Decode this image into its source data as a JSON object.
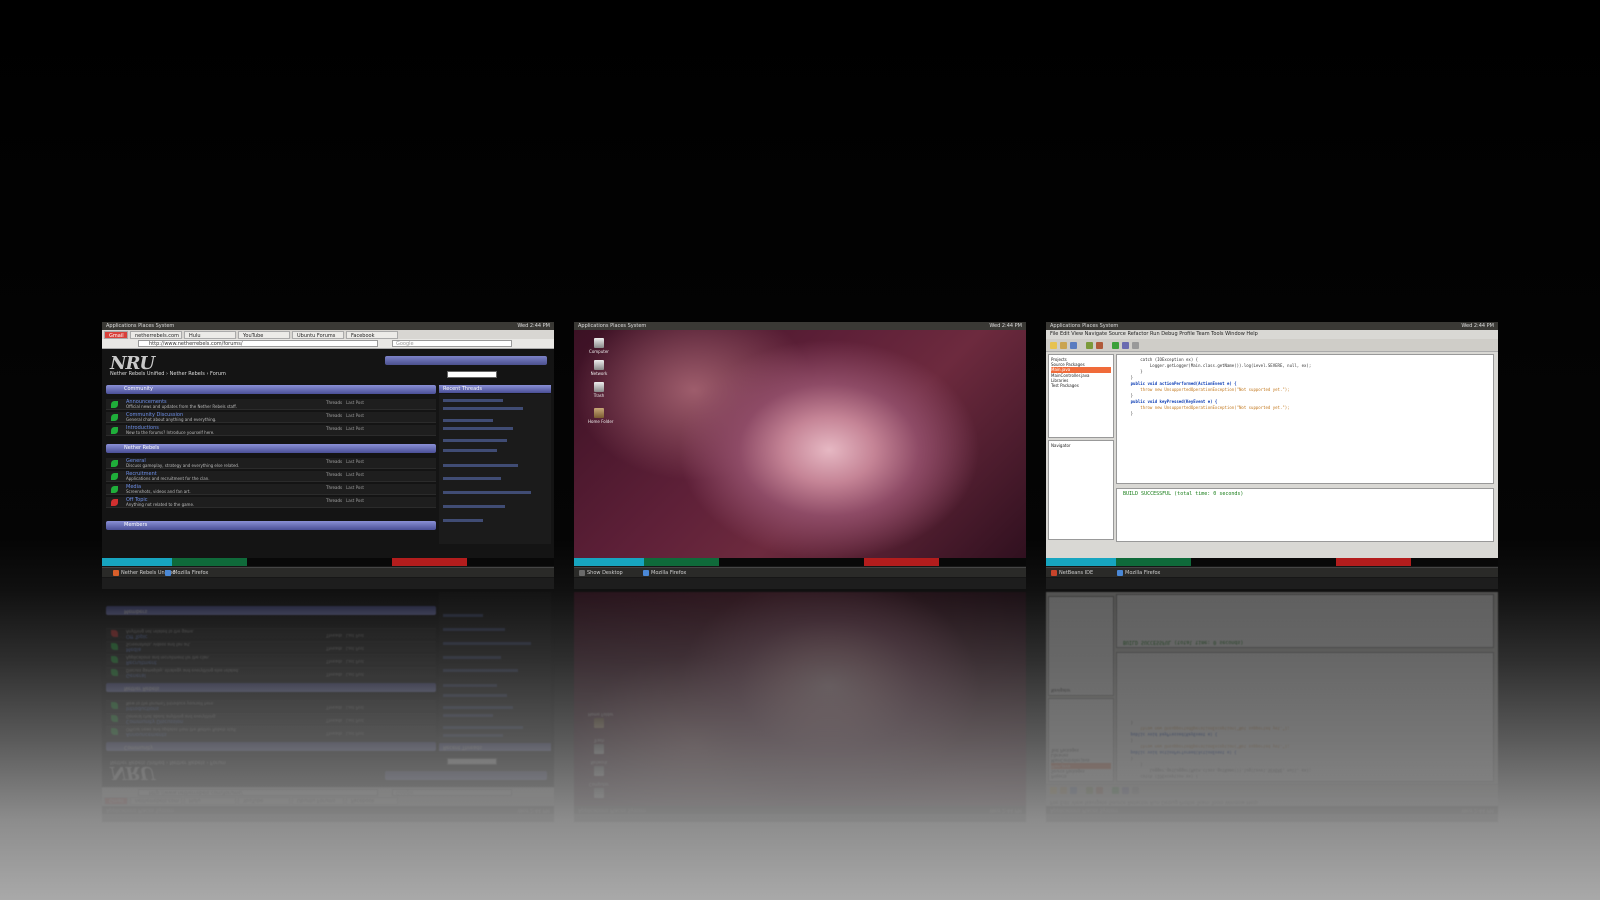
{
  "workspaces": [
    {
      "id": "browser",
      "topbar": {
        "title": "Applications Places System",
        "clock": "Wed 2:44 PM"
      },
      "browser": {
        "window_title": "Nether Rebels Unified - Mozilla Firefox",
        "tabs": [
          "Gmail",
          "netherrebels.com",
          "Hulu",
          "YouTube",
          "Ubuntu Forums",
          "Facebook"
        ],
        "url": "http://www.netherrebels.com/forums/",
        "search_placeholder": "Google"
      },
      "forum": {
        "logo": "NRU",
        "breadcrumb": "Nether Rebels Unified › Nether Rebels › Forum",
        "categories": [
          {
            "title": "Community",
            "rows": [
              {
                "title": "Announcements",
                "desc": "Official news and updates from the Nether Rebels staff.",
                "stat": "Threads",
                "last": "Last Post"
              },
              {
                "title": "Community Discussion",
                "desc": "General chat about anything and everything.",
                "stat": "Threads",
                "last": "Last Post"
              },
              {
                "title": "Introductions",
                "desc": "New to the forums? Introduce yourself here.",
                "stat": "Threads",
                "last": "Last Post"
              }
            ]
          },
          {
            "title": "Nether Rebels",
            "rows": [
              {
                "title": "General",
                "desc": "Discuss gameplay, strategy and everything else related.",
                "stat": "Threads",
                "last": "Last Post"
              },
              {
                "title": "Recruitment",
                "desc": "Applications and recruitment for the clan.",
                "stat": "Threads",
                "last": "Last Post"
              },
              {
                "title": "Media",
                "desc": "Screenshots, videos and fan art.",
                "stat": "Threads",
                "last": "Last Post"
              },
              {
                "title": "Off Topic",
                "desc": "Anything not related to the game.",
                "stat": "Threads",
                "last": "Last Post"
              }
            ]
          },
          {
            "title": "Members",
            "rows": []
          }
        ],
        "sidebar_title": "Recent Threads"
      },
      "taskbar": [
        {
          "label": "Nether Rebels Unified",
          "color": "#d95f2a"
        },
        {
          "label": "Mozilla Firefox",
          "color": "#4a88d6"
        }
      ]
    },
    {
      "id": "desktop",
      "topbar": {
        "title": "Applications Places System",
        "clock": "Wed 2:44 PM"
      },
      "desktop_icons": [
        {
          "label": "Computer"
        },
        {
          "label": "Network"
        },
        {
          "label": "Trash"
        },
        {
          "label": "Home Folder"
        }
      ],
      "taskbar": [
        {
          "label": "Show Desktop",
          "color": "#6a6a6a"
        },
        {
          "label": "Mozilla Firefox",
          "color": "#4a88d6"
        }
      ]
    },
    {
      "id": "ide",
      "topbar": {
        "title": "Applications Places System",
        "clock": "Wed 2:44 PM"
      },
      "ide": {
        "menu": "File Edit View Navigate Source Refactor Run Debug Profile Team Tools Window Help",
        "tree": [
          "Projects",
          "  Source Packages",
          "    Main.java",
          "    MainController.java",
          "  Libraries",
          "  Test Packages",
          "Navigator"
        ],
        "code": [
          "        catch (IOException ex) {",
          "            Logger.getLogger(Main.class.getName()).log(Level.SEVERE, null, ex);",
          "        }",
          "    }",
          "",
          "    public void actionPerformed(ActionEvent e) {",
          "        throw new UnsupportedOperationException(\"Not supported yet.\");",
          "    }",
          "",
          "    public void keyPressed(KeyEvent e) {",
          "        throw new UnsupportedOperationException(\"Not supported yet.\");",
          "    }"
        ],
        "console_text": "BUILD SUCCESSFUL (total time: 0 seconds)"
      },
      "taskbar": [
        {
          "label": "NetBeans IDE",
          "color": "#c8442b"
        },
        {
          "label": "Mozilla Firefox",
          "color": "#4a88d6"
        }
      ]
    }
  ]
}
